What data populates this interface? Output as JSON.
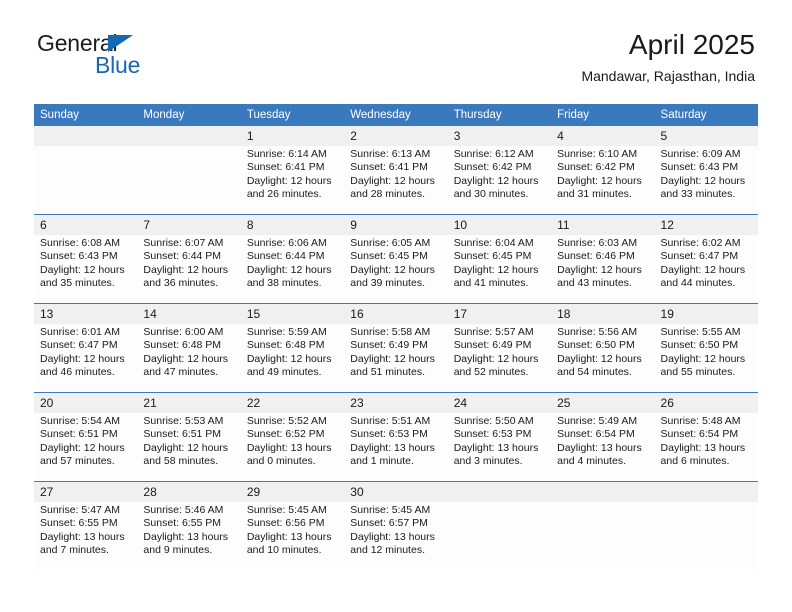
{
  "brand": {
    "name_part1": "General",
    "name_part2": "Blue",
    "accent_color": "#1569b4",
    "triangle_icon": "logo-triangle-icon"
  },
  "header": {
    "title": "April 2025",
    "subtitle": "Mandawar, Rajasthan, India"
  },
  "theme": {
    "header_blue": "#3a79bd",
    "daynum_band": "#f0f0f0",
    "cell_background": "#fdfdfd"
  },
  "weekday_headers": [
    "Sunday",
    "Monday",
    "Tuesday",
    "Wednesday",
    "Thursday",
    "Friday",
    "Saturday"
  ],
  "weeks": [
    [
      {
        "day": "",
        "sunrise": "",
        "sunset": "",
        "daylight_line1": "",
        "daylight_line2": ""
      },
      {
        "day": "",
        "sunrise": "",
        "sunset": "",
        "daylight_line1": "",
        "daylight_line2": ""
      },
      {
        "day": "1",
        "sunrise": "Sunrise: 6:14 AM",
        "sunset": "Sunset: 6:41 PM",
        "daylight_line1": "Daylight: 12 hours",
        "daylight_line2": "and 26 minutes."
      },
      {
        "day": "2",
        "sunrise": "Sunrise: 6:13 AM",
        "sunset": "Sunset: 6:41 PM",
        "daylight_line1": "Daylight: 12 hours",
        "daylight_line2": "and 28 minutes."
      },
      {
        "day": "3",
        "sunrise": "Sunrise: 6:12 AM",
        "sunset": "Sunset: 6:42 PM",
        "daylight_line1": "Daylight: 12 hours",
        "daylight_line2": "and 30 minutes."
      },
      {
        "day": "4",
        "sunrise": "Sunrise: 6:10 AM",
        "sunset": "Sunset: 6:42 PM",
        "daylight_line1": "Daylight: 12 hours",
        "daylight_line2": "and 31 minutes."
      },
      {
        "day": "5",
        "sunrise": "Sunrise: 6:09 AM",
        "sunset": "Sunset: 6:43 PM",
        "daylight_line1": "Daylight: 12 hours",
        "daylight_line2": "and 33 minutes."
      }
    ],
    [
      {
        "day": "6",
        "sunrise": "Sunrise: 6:08 AM",
        "sunset": "Sunset: 6:43 PM",
        "daylight_line1": "Daylight: 12 hours",
        "daylight_line2": "and 35 minutes."
      },
      {
        "day": "7",
        "sunrise": "Sunrise: 6:07 AM",
        "sunset": "Sunset: 6:44 PM",
        "daylight_line1": "Daylight: 12 hours",
        "daylight_line2": "and 36 minutes."
      },
      {
        "day": "8",
        "sunrise": "Sunrise: 6:06 AM",
        "sunset": "Sunset: 6:44 PM",
        "daylight_line1": "Daylight: 12 hours",
        "daylight_line2": "and 38 minutes."
      },
      {
        "day": "9",
        "sunrise": "Sunrise: 6:05 AM",
        "sunset": "Sunset: 6:45 PM",
        "daylight_line1": "Daylight: 12 hours",
        "daylight_line2": "and 39 minutes."
      },
      {
        "day": "10",
        "sunrise": "Sunrise: 6:04 AM",
        "sunset": "Sunset: 6:45 PM",
        "daylight_line1": "Daylight: 12 hours",
        "daylight_line2": "and 41 minutes."
      },
      {
        "day": "11",
        "sunrise": "Sunrise: 6:03 AM",
        "sunset": "Sunset: 6:46 PM",
        "daylight_line1": "Daylight: 12 hours",
        "daylight_line2": "and 43 minutes."
      },
      {
        "day": "12",
        "sunrise": "Sunrise: 6:02 AM",
        "sunset": "Sunset: 6:47 PM",
        "daylight_line1": "Daylight: 12 hours",
        "daylight_line2": "and 44 minutes."
      }
    ],
    [
      {
        "day": "13",
        "sunrise": "Sunrise: 6:01 AM",
        "sunset": "Sunset: 6:47 PM",
        "daylight_line1": "Daylight: 12 hours",
        "daylight_line2": "and 46 minutes."
      },
      {
        "day": "14",
        "sunrise": "Sunrise: 6:00 AM",
        "sunset": "Sunset: 6:48 PM",
        "daylight_line1": "Daylight: 12 hours",
        "daylight_line2": "and 47 minutes."
      },
      {
        "day": "15",
        "sunrise": "Sunrise: 5:59 AM",
        "sunset": "Sunset: 6:48 PM",
        "daylight_line1": "Daylight: 12 hours",
        "daylight_line2": "and 49 minutes."
      },
      {
        "day": "16",
        "sunrise": "Sunrise: 5:58 AM",
        "sunset": "Sunset: 6:49 PM",
        "daylight_line1": "Daylight: 12 hours",
        "daylight_line2": "and 51 minutes."
      },
      {
        "day": "17",
        "sunrise": "Sunrise: 5:57 AM",
        "sunset": "Sunset: 6:49 PM",
        "daylight_line1": "Daylight: 12 hours",
        "daylight_line2": "and 52 minutes."
      },
      {
        "day": "18",
        "sunrise": "Sunrise: 5:56 AM",
        "sunset": "Sunset: 6:50 PM",
        "daylight_line1": "Daylight: 12 hours",
        "daylight_line2": "and 54 minutes."
      },
      {
        "day": "19",
        "sunrise": "Sunrise: 5:55 AM",
        "sunset": "Sunset: 6:50 PM",
        "daylight_line1": "Daylight: 12 hours",
        "daylight_line2": "and 55 minutes."
      }
    ],
    [
      {
        "day": "20",
        "sunrise": "Sunrise: 5:54 AM",
        "sunset": "Sunset: 6:51 PM",
        "daylight_line1": "Daylight: 12 hours",
        "daylight_line2": "and 57 minutes."
      },
      {
        "day": "21",
        "sunrise": "Sunrise: 5:53 AM",
        "sunset": "Sunset: 6:51 PM",
        "daylight_line1": "Daylight: 12 hours",
        "daylight_line2": "and 58 minutes."
      },
      {
        "day": "22",
        "sunrise": "Sunrise: 5:52 AM",
        "sunset": "Sunset: 6:52 PM",
        "daylight_line1": "Daylight: 13 hours",
        "daylight_line2": "and 0 minutes."
      },
      {
        "day": "23",
        "sunrise": "Sunrise: 5:51 AM",
        "sunset": "Sunset: 6:53 PM",
        "daylight_line1": "Daylight: 13 hours",
        "daylight_line2": "and 1 minute."
      },
      {
        "day": "24",
        "sunrise": "Sunrise: 5:50 AM",
        "sunset": "Sunset: 6:53 PM",
        "daylight_line1": "Daylight: 13 hours",
        "daylight_line2": "and 3 minutes."
      },
      {
        "day": "25",
        "sunrise": "Sunrise: 5:49 AM",
        "sunset": "Sunset: 6:54 PM",
        "daylight_line1": "Daylight: 13 hours",
        "daylight_line2": "and 4 minutes."
      },
      {
        "day": "26",
        "sunrise": "Sunrise: 5:48 AM",
        "sunset": "Sunset: 6:54 PM",
        "daylight_line1": "Daylight: 13 hours",
        "daylight_line2": "and 6 minutes."
      }
    ],
    [
      {
        "day": "27",
        "sunrise": "Sunrise: 5:47 AM",
        "sunset": "Sunset: 6:55 PM",
        "daylight_line1": "Daylight: 13 hours",
        "daylight_line2": "and 7 minutes."
      },
      {
        "day": "28",
        "sunrise": "Sunrise: 5:46 AM",
        "sunset": "Sunset: 6:55 PM",
        "daylight_line1": "Daylight: 13 hours",
        "daylight_line2": "and 9 minutes."
      },
      {
        "day": "29",
        "sunrise": "Sunrise: 5:45 AM",
        "sunset": "Sunset: 6:56 PM",
        "daylight_line1": "Daylight: 13 hours",
        "daylight_line2": "and 10 minutes."
      },
      {
        "day": "30",
        "sunrise": "Sunrise: 5:45 AM",
        "sunset": "Sunset: 6:57 PM",
        "daylight_line1": "Daylight: 13 hours",
        "daylight_line2": "and 12 minutes."
      },
      {
        "day": "",
        "sunrise": "",
        "sunset": "",
        "daylight_line1": "",
        "daylight_line2": ""
      },
      {
        "day": "",
        "sunrise": "",
        "sunset": "",
        "daylight_line1": "",
        "daylight_line2": ""
      },
      {
        "day": "",
        "sunrise": "",
        "sunset": "",
        "daylight_line1": "",
        "daylight_line2": ""
      }
    ]
  ]
}
